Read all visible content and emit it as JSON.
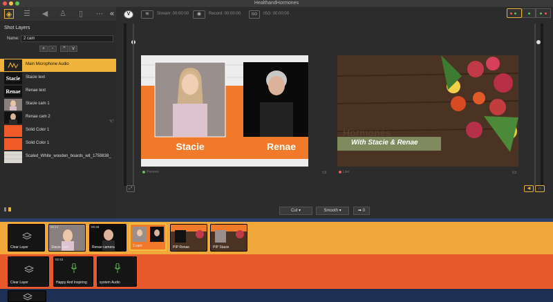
{
  "window": {
    "title": "HealthandHormones",
    "traffic_lights": [
      "#ee5c55",
      "#f4bd4f",
      "#5fc454"
    ]
  },
  "left_panel": {
    "toolbar_icons": [
      "layers-icon",
      "sliders-icon",
      "speaker-icon",
      "person-icon",
      "phone-icon",
      "more-icon",
      "collapse-icon"
    ],
    "section_title": "Shot Layers",
    "name_label": "Name:",
    "name_value": "2 cam",
    "controls": [
      "+",
      "-",
      "^",
      "v"
    ],
    "layers": [
      {
        "label": "Main Microphone Audio",
        "selected": true,
        "thumb": "audio"
      },
      {
        "label": "Stacie text",
        "selected": false,
        "thumb": "Stacie"
      },
      {
        "label": "Renae text",
        "selected": false,
        "thumb": "Renae"
      },
      {
        "label": "Stacie cam 1",
        "selected": false,
        "thumb": "cam1"
      },
      {
        "label": "Renae cam 2",
        "selected": false,
        "thumb": "cam2"
      },
      {
        "label": "Solid Color 1",
        "selected": false,
        "thumb": "color"
      },
      {
        "label": "Solid Color 1",
        "selected": false,
        "thumb": "color"
      },
      {
        "label": "Scaled_White_wooden_boards_wit_1759838_",
        "selected": false,
        "thumb": "wood"
      }
    ]
  },
  "header": {
    "stream_label": "Stream: 00:00:00",
    "record_label": "Record: 00:00:00",
    "iso_label": "ISO: 00:00:00",
    "iso_badge": "ISO"
  },
  "preview": {
    "name_left": "Stacie",
    "name_right": "Renae",
    "status": "Preview"
  },
  "program": {
    "title_text": "Hormones",
    "subtitle": "With Stacie & Renae",
    "status": "Live"
  },
  "transitions": {
    "cut": "Cut",
    "smooth": "Smooth",
    "go_value": "0"
  },
  "timeline": {
    "video_shots": [
      {
        "label": "Clear Layer",
        "time": "",
        "kind": "clear"
      },
      {
        "label": "Stacie cam",
        "time": "00:14",
        "kind": "cam1"
      },
      {
        "label": "Renae camera",
        "time": "00:28",
        "kind": "cam2"
      },
      {
        "label": "2 cam",
        "time": "",
        "kind": "two",
        "live": true
      },
      {
        "label": "PIP Renae",
        "time": "",
        "kind": "pip"
      },
      {
        "label": "PIP Stacie",
        "time": "",
        "kind": "pip"
      }
    ],
    "audio_shots": [
      {
        "label": "Clear Layer",
        "time": "",
        "kind": "clear"
      },
      {
        "label": "Happy And Inspiring",
        "time": "02:43",
        "kind": "mic"
      },
      {
        "label": "system Audio",
        "time": "",
        "kind": "mic"
      }
    ]
  },
  "colors": {
    "accent": "#f0b43c",
    "video_track": "#f0a83a",
    "audio_track": "#e85a2a",
    "lower_track": "#1d2f52",
    "orange_banner": "#f07a2a"
  }
}
